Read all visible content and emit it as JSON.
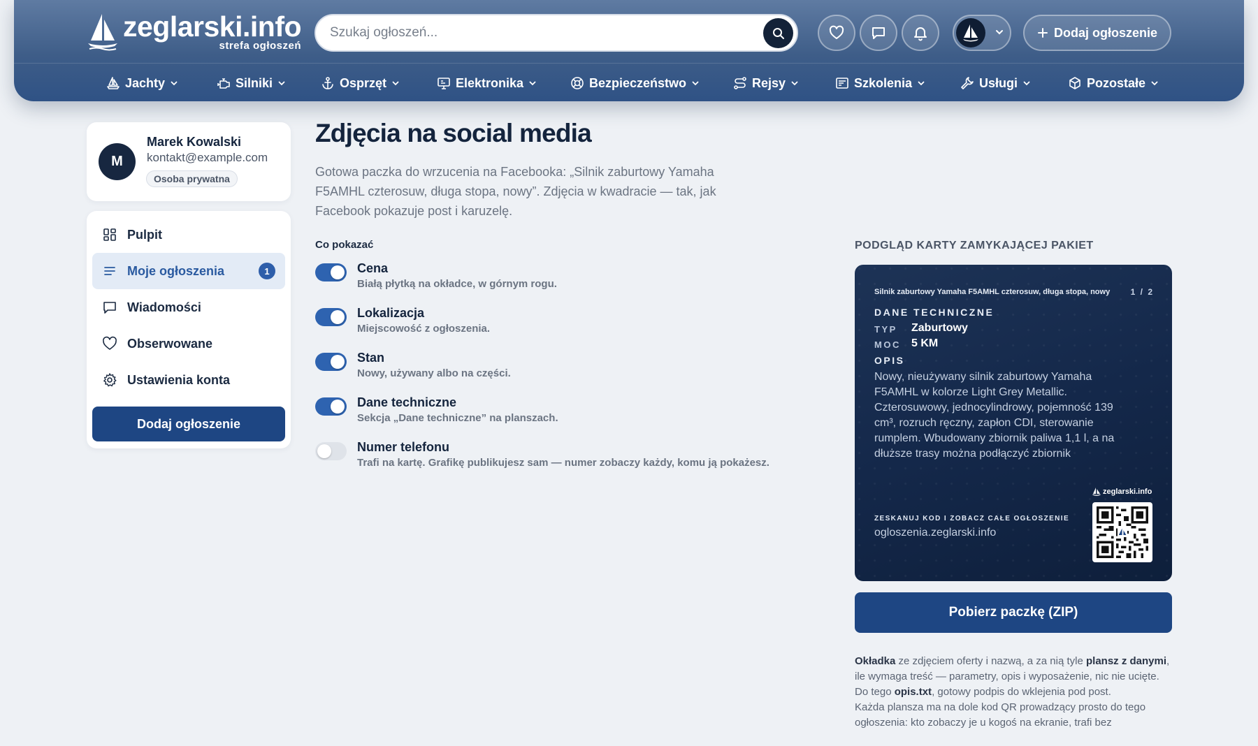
{
  "header": {
    "logo_title": "zeglarski.info",
    "logo_sub": "strefa ogłoszeń",
    "search_placeholder": "Szukaj ogłoszeń...",
    "add_label": "Dodaj ogłoszenie",
    "nav": [
      {
        "label": "Jachty",
        "icon": "boat-icon"
      },
      {
        "label": "Silniki",
        "icon": "engine-icon"
      },
      {
        "label": "Osprzęt",
        "icon": "anchor-icon"
      },
      {
        "label": "Elektronika",
        "icon": "monitor-icon"
      },
      {
        "label": "Bezpieczeństwo",
        "icon": "lifebuoy-icon"
      },
      {
        "label": "Rejsy",
        "icon": "route-icon"
      },
      {
        "label": "Szkolenia",
        "icon": "presentation-icon"
      },
      {
        "label": "Usługi",
        "icon": "wrench-icon"
      },
      {
        "label": "Pozostałe",
        "icon": "box-icon"
      }
    ]
  },
  "user": {
    "initial": "M",
    "name": "Marek Kowalski",
    "email": "kontakt@example.com",
    "badge": "Osoba prywatna"
  },
  "sidebar": {
    "items": [
      {
        "label": "Pulpit",
        "icon": "dashboard-icon"
      },
      {
        "label": "Moje ogłoszenia",
        "icon": "list-icon",
        "badge": "1",
        "active": true
      },
      {
        "label": "Wiadomości",
        "icon": "message-icon"
      },
      {
        "label": "Obserwowane",
        "icon": "heart-icon"
      },
      {
        "label": "Ustawienia konta",
        "icon": "gear-icon"
      }
    ],
    "add_label": "Dodaj ogłoszenie"
  },
  "main": {
    "title": "Zdjęcia na social media",
    "description": "Gotowa paczka do wrzucenia na Facebooka: „Silnik zaburtowy Yamaha F5AMHL czterosuw, długa stopa, nowy”. Zdjęcia w kwadracie — tak, jak Facebook pokazuje post i karuzelę.",
    "section_label": "Co pokazać",
    "options": [
      {
        "title": "Cena",
        "desc": "Białą płytką na okładce, w górnym rogu.",
        "on": true
      },
      {
        "title": "Lokalizacja",
        "desc": "Miejscowość z ogłoszenia.",
        "on": true
      },
      {
        "title": "Stan",
        "desc": "Nowy, używany albo na części.",
        "on": true
      },
      {
        "title": "Dane techniczne",
        "desc": "Sekcja „Dane techniczne” na planszach.",
        "on": true
      },
      {
        "title": "Numer telefonu",
        "desc": "Trafi na kartę. Grafikę publikujesz sam — numer zobaczy każdy, komu ją pokażesz.",
        "on": false
      }
    ]
  },
  "preview": {
    "label": "PODGLĄD KARTY ZAMYKAJĄCEJ PAKIET",
    "head": "Silnik zaburtowy Yamaha F5AMHL czterosuw, długa stopa, nowy",
    "page": "1 / 2",
    "tech_title": "DANE TECHNICZNE",
    "typ_key": "TYP",
    "typ_val": "Zaburtowy",
    "moc_key": "MOC",
    "moc_val": "5 KM",
    "opis_title": "OPIS",
    "opis_text": "Nowy, nieużywany silnik zaburtowy Yamaha F5AMHL w kolorze Light Grey Metallic. Czterosuwowy, jednocylindrowy, pojemność 139 cm³, rozruch ręczny, zapłon CDI, sterowanie rumplem. Wbudowany zbiornik paliwa 1,1 l, a na dłuższe trasy można podłączyć zbiornik",
    "brand": "zeglarski.info",
    "scan_text": "ZESKANUJ KOD I ZOBACZ CAŁE OGŁOSZENIE",
    "url": "ogloszenia.zeglarski.info",
    "download_label": "Pobierz paczkę (ZIP)"
  },
  "note": {
    "p1_a": "Okładka",
    "p1_b": " ze zdjęciem oferty i nazwą, a za nią tyle ",
    "p1_c": "plansz z danymi",
    "p1_d": ", ile wymaga treść — parametry, opis i wyposażenie, nic nie ucięte. Do tego ",
    "p1_e": "opis.txt",
    "p1_f": ", gotowy podpis do wklejenia pod post.",
    "p2": "Każda plansza ma na dole kod QR prowadzący prosto do tego ogłoszenia: kto zobaczy je u kogoś na ekranie, trafi bez"
  },
  "colors": {
    "accent": "#2e63b0",
    "primary_button": "#1e4683",
    "header_top": "#5f7ba2",
    "header_bottom": "#2f5285",
    "preview_bg": "#14284a"
  }
}
